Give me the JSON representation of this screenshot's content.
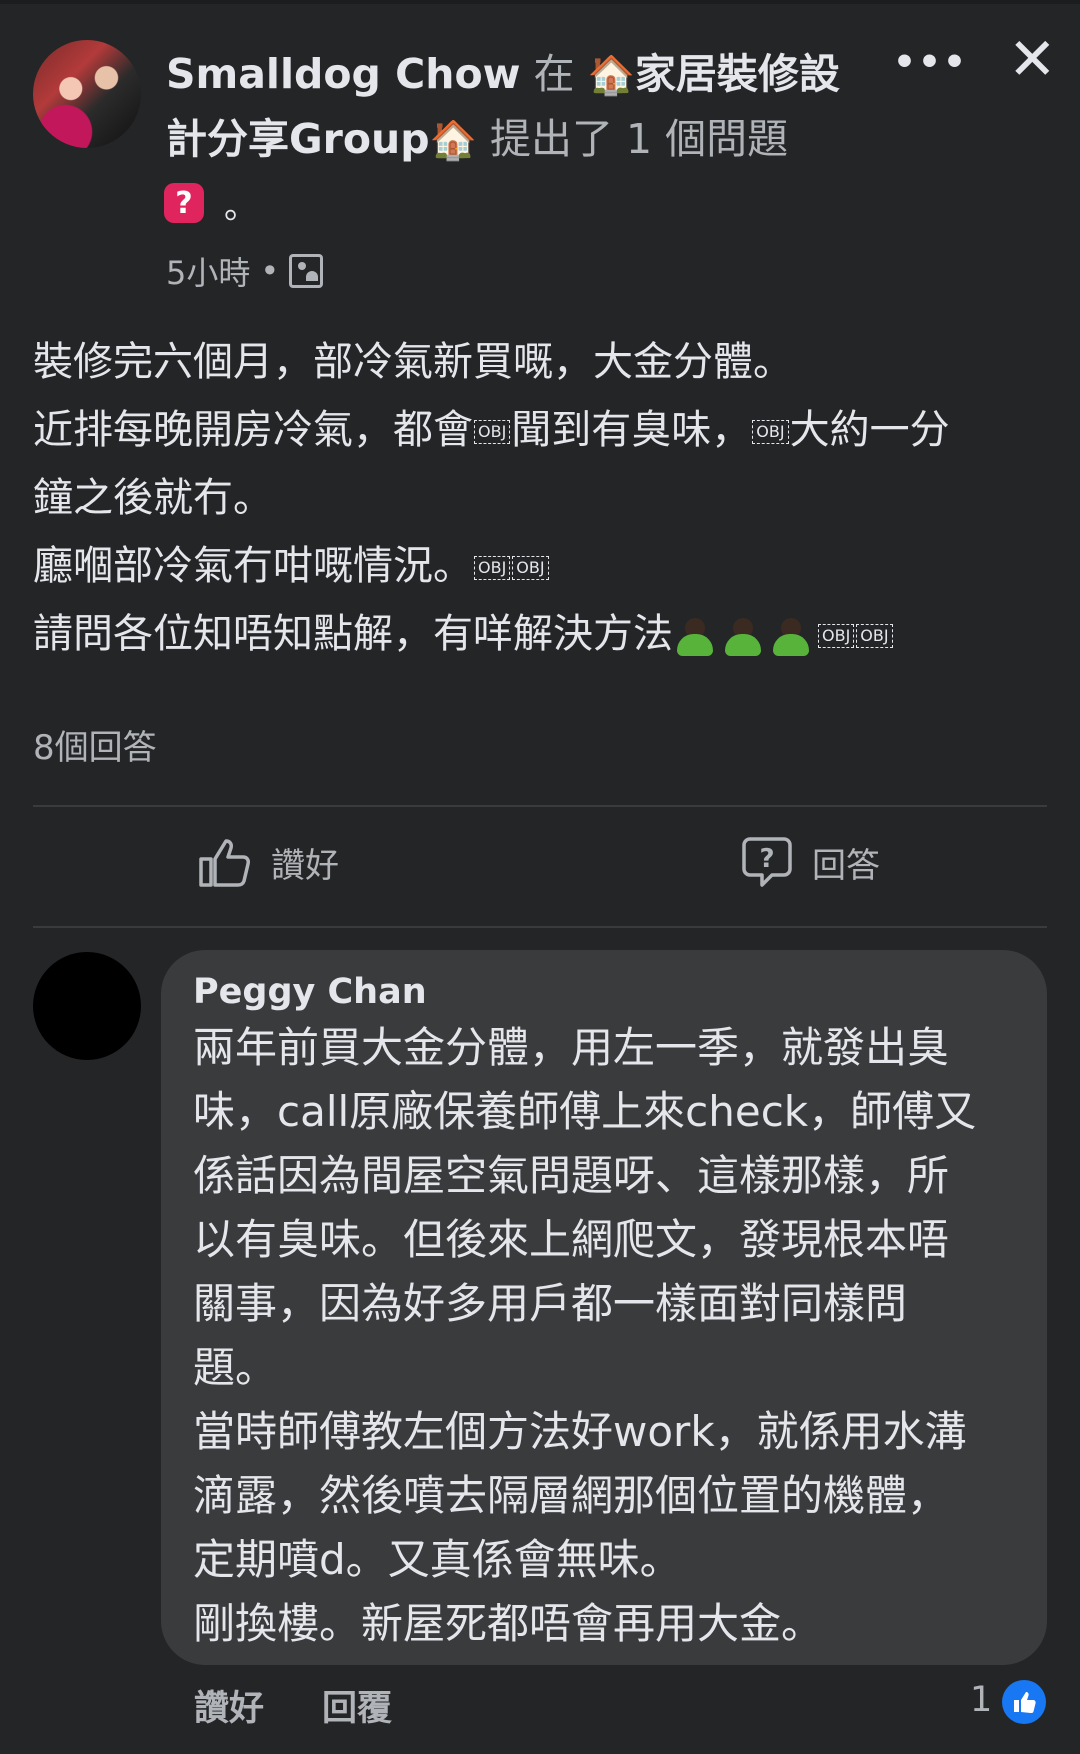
{
  "header": {
    "author": "Smalldog Chow",
    "in_word": "在",
    "group_line1": "家居裝修設",
    "group_line2": "計分享Group",
    "action_text": "提出了 1 個問題",
    "house_glyph": "🏠",
    "question_badge": "?",
    "question_end": "。",
    "time": "5小時",
    "dot": "•",
    "icons": [
      "more-icon",
      "close-icon",
      "group-privacy-icon",
      "question-badge-icon"
    ]
  },
  "post": {
    "line1": "裝修完六個月，部冷氣新買嘅，大金分體。",
    "line2a": "近排每晚開房冷氣，都會",
    "line2b": "聞到有臭味，",
    "line2c": "大約一分",
    "line3": "鐘之後就冇。",
    "line4": "廳嗰部冷氣冇咁嘅情況。",
    "line5": "請問各位知唔知點解，有咩解決方法",
    "obj_glyph": "OBJ"
  },
  "answers_count": "8個回答",
  "actions": {
    "like_label": "讚好",
    "answer_label": "回答"
  },
  "comment": {
    "name": "Peggy Chan",
    "lines": [
      "兩年前買大金分體，用左一季，就發出臭",
      "味，call原廠保養師傅上來check，師傅又",
      "係話因為間屋空氣問題呀、這樣那樣，所",
      "以有臭味。但後來上網爬文，發現根本唔",
      "關事，因為好多用戶都一樣面對同樣問",
      "題。",
      "當時師傅教左個方法好work，就係用水溝",
      "滴露，然後噴去隔層網那個位置的機體，",
      "定期噴d。又真係會無味。",
      "剛換樓。新屋死都唔會再用大金。"
    ],
    "like_label": "讚好",
    "reply_label": "回覆",
    "reaction_count": "1"
  },
  "colors": {
    "background": "#242526",
    "bubble": "#3a3b3c",
    "text": "#e4e6eb",
    "muted": "#b0b3b8",
    "like_blue": "#1877f2",
    "question_red": "#e0245e"
  }
}
